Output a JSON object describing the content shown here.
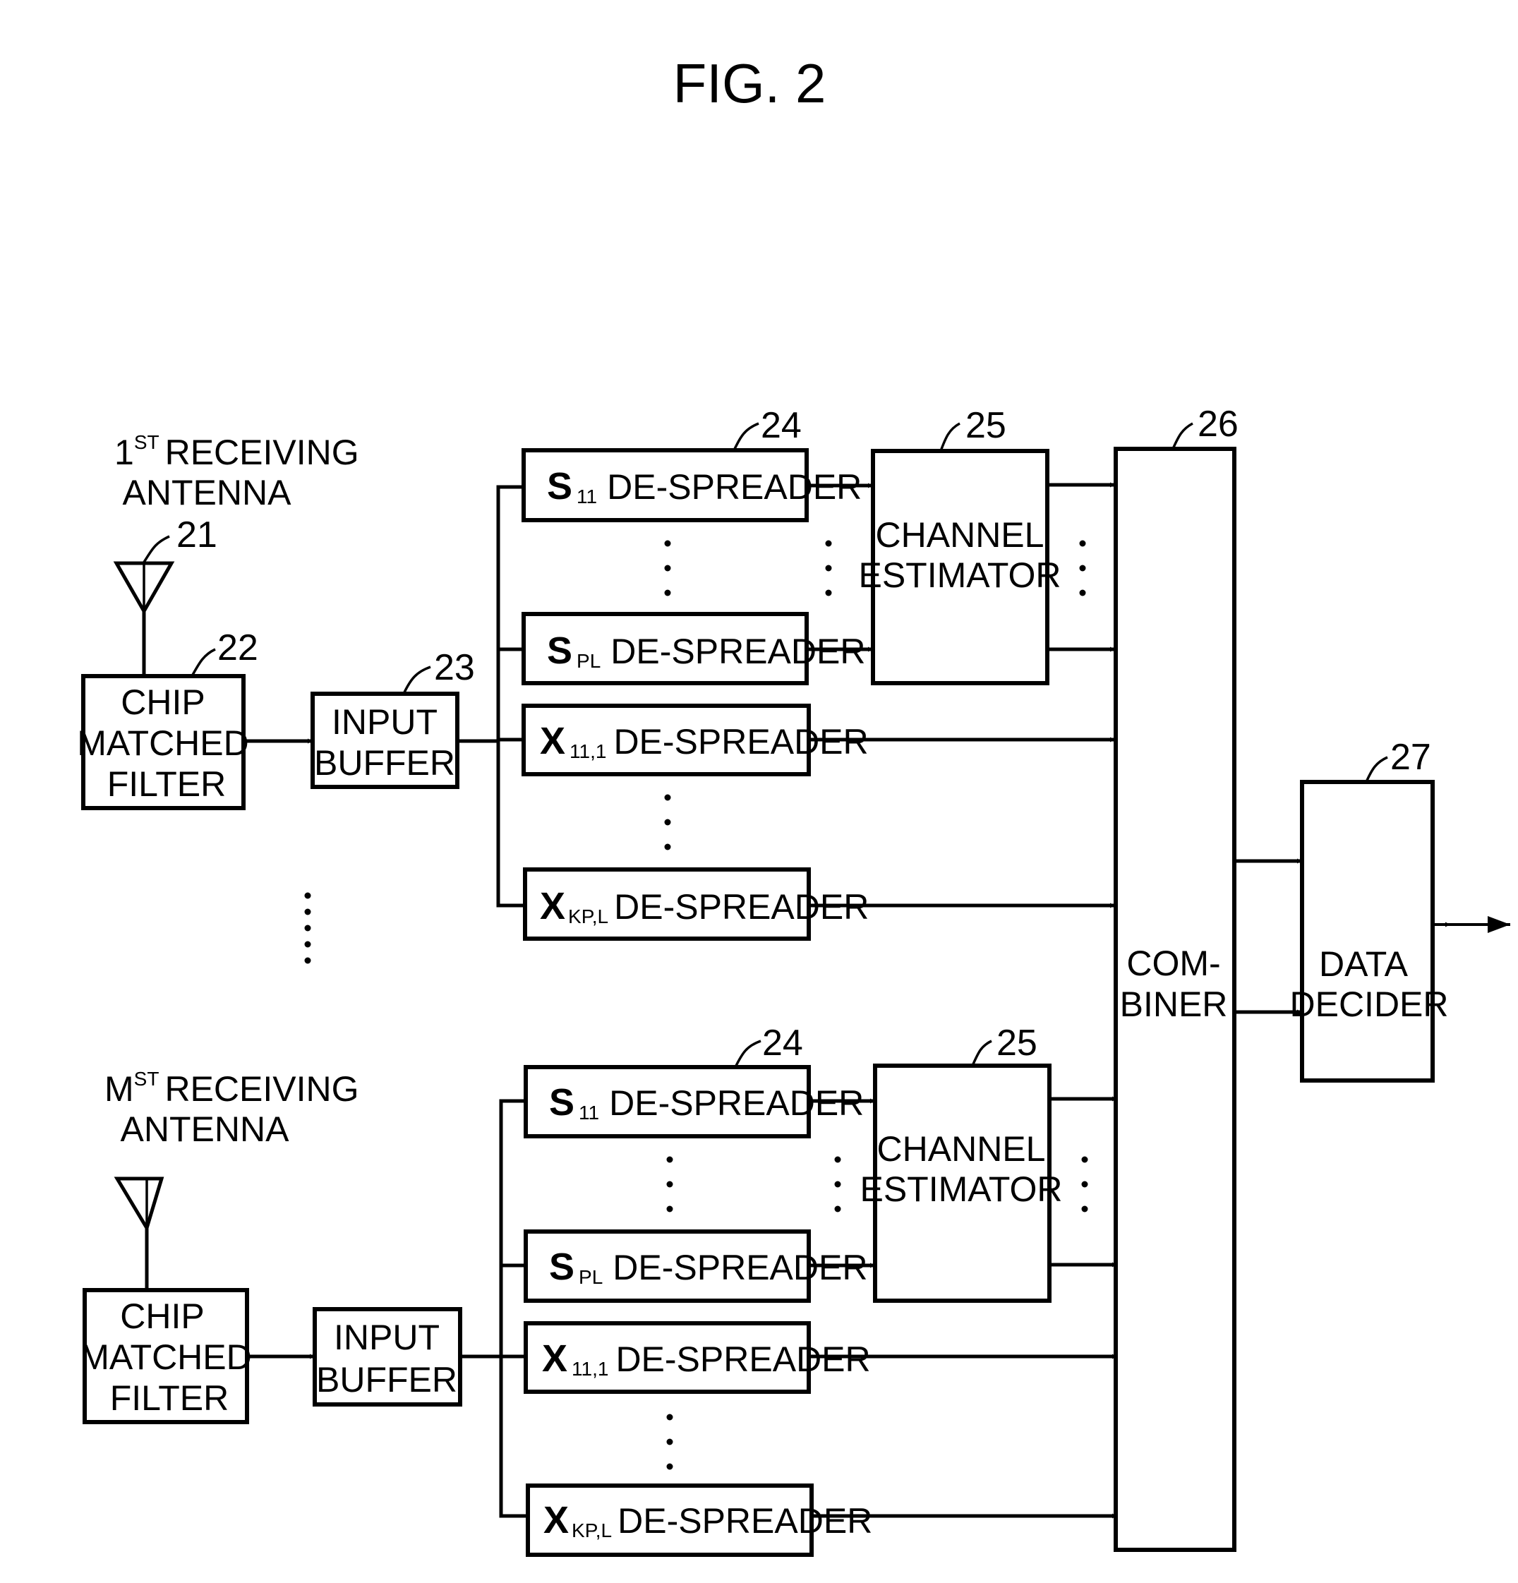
{
  "figure": {
    "title": "FIG. 2"
  },
  "antennas": [
    {
      "label_prefix": "1",
      "label_sup": "ST",
      "label_line1": "RECEIVING",
      "label_line2": "ANTENNA",
      "ref": "21"
    },
    {
      "label_prefix": "M",
      "label_sup": "ST",
      "label_line1": "RECEIVING",
      "label_line2": "ANTENNA",
      "ref": ""
    }
  ],
  "chip_matched_filter": {
    "lines": [
      "CHIP",
      "MATCHED",
      "FILTER"
    ],
    "ref": "22"
  },
  "input_buffer": {
    "lines": [
      "INPUT",
      "BUFFER"
    ],
    "ref": "23"
  },
  "despreaders": {
    "ref": "24",
    "suffix": "DE-SPREADER",
    "items": [
      {
        "symbol": "S",
        "subscript": "11"
      },
      {
        "symbol": "S",
        "subscript": "PL"
      },
      {
        "symbol": "X",
        "subscript": "11,1"
      },
      {
        "symbol": "X",
        "subscript": "KP,L"
      }
    ]
  },
  "channel_estimator": {
    "lines": [
      "CHANNEL",
      "ESTIMATOR"
    ],
    "ref": "25"
  },
  "combiner": {
    "lines": [
      "COM-",
      "BINER"
    ],
    "ref": "26"
  },
  "data_decider": {
    "lines": [
      "DATA",
      "DECIDER"
    ],
    "ref": "27"
  },
  "ellipsis": "⋮"
}
